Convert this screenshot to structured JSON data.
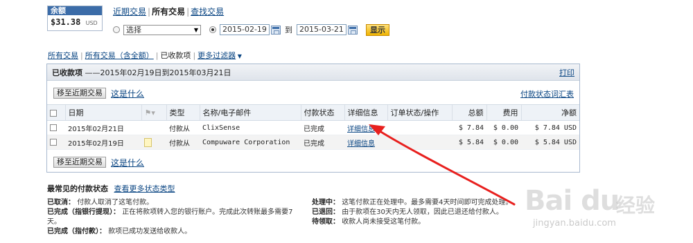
{
  "balance": {
    "label": "余额",
    "amount": "$31.38",
    "currency": "USD"
  },
  "top_tabs": {
    "recent": "近期交易",
    "all": "所有交易",
    "find": "查找交易"
  },
  "filter": {
    "select_value": "选择",
    "date_from": "2015-02-19",
    "to_label": "到",
    "date_to": "2015-03-21",
    "show_button": "显示"
  },
  "sub_tabs": {
    "all": "所有交易",
    "all_incl_fees": "所有交易（含全额）",
    "received": "已收款项",
    "more_filters": "更多过滤器"
  },
  "panel": {
    "title_bold": "已收款项",
    "title_range": "——2015年02月19日到2015年03月21日",
    "print": "打印",
    "move_button": "移至近期交易",
    "what_link": "这是什么",
    "summary_link": "付款状态词汇表"
  },
  "table": {
    "headers": [
      "日期",
      "类型",
      "名称/电子邮件",
      "付款状态",
      "详细信息",
      "订单状态/操作",
      "总额",
      "费用",
      "净额"
    ],
    "rows": [
      {
        "date": "2015年02月21日",
        "type": "付款从",
        "name": "ClixSense",
        "status": "已完成",
        "details": "详细信息",
        "gross": "$ 7.84",
        "fee": "$ 0.00",
        "net": "$ 7.84 USD"
      },
      {
        "date": "2015年02月19日",
        "type": "付款从",
        "name": "Compuware Corporation",
        "status": "已完成",
        "details": "详细信息",
        "gross": "$ 5.84",
        "fee": "$ 0.00",
        "net": "$ 5.84 USD"
      }
    ]
  },
  "status_section": {
    "title": "最常见的付款状态",
    "more_link": "查看更多状态类型",
    "left": [
      {
        "term": "已取消：",
        "desc": "付款人取消了这笔付款。"
      },
      {
        "term": "已完成（指银行提现）：",
        "desc": "正在将款项转入您的银行账户。完成此次转账最多需要7天。"
      },
      {
        "term": "已完成（指付款）：",
        "desc": "款项已成功发送给收款人。"
      }
    ],
    "right": [
      {
        "term": "处理中：",
        "desc": "这笔付款正在处理中。最多需要4天时间即可完成处理。"
      },
      {
        "term": "已退回：",
        "desc": "由于款项在30天内无人领取，因此已退还给付款人。"
      },
      {
        "term": "待领取：",
        "desc": "收款人尚未接受这笔付款。"
      }
    ]
  },
  "watermark": {
    "logo": "Bai du",
    "cn": "经验",
    "url": "jingyan.baidu.com"
  },
  "colors": {
    "link": "#084482",
    "header_blue": "#3b6ca8",
    "arrow_red": "#e8201e",
    "button_gold": "#f0b400"
  }
}
